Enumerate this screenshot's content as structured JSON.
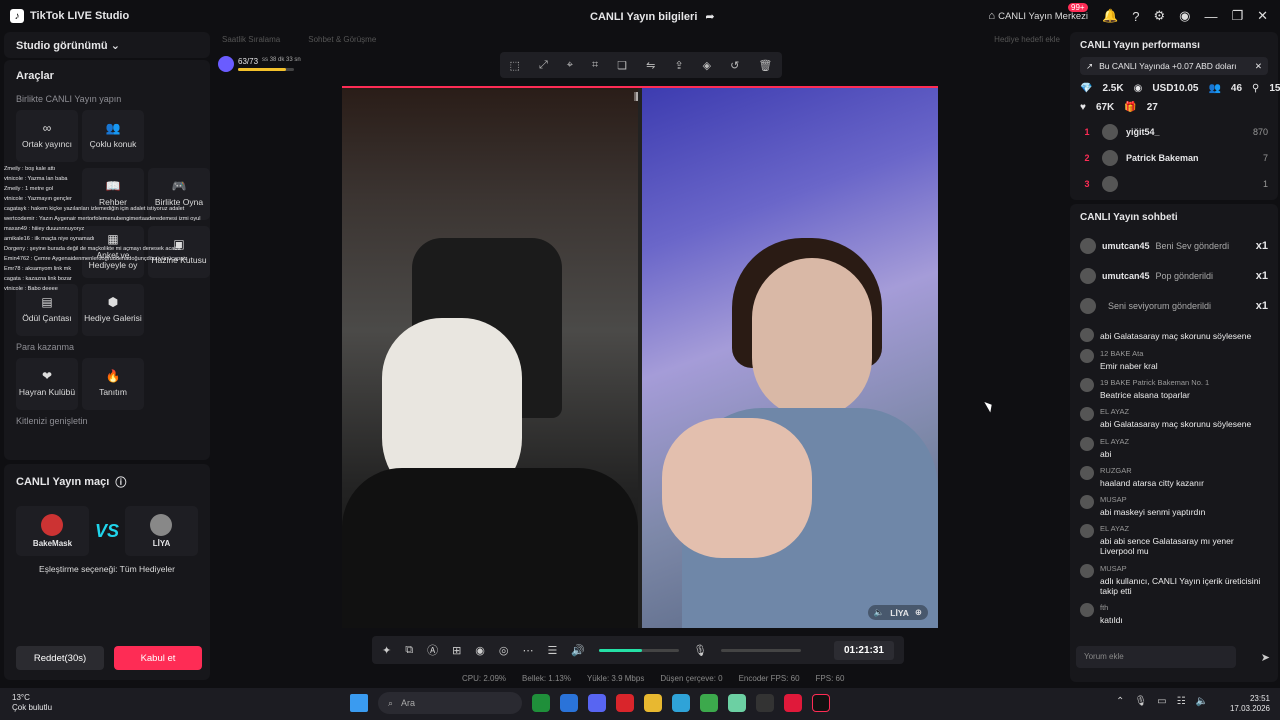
{
  "window": {
    "app_title": "TikTok LIVE Studio",
    "center_title": "CANLI Yayın bilgileri",
    "center_right": "CANLI Yayın Merkezi",
    "notif_badge": "99+"
  },
  "left": {
    "studio_view": "Studio görünümü",
    "tools_title": "Araçlar",
    "section_live_together": "Birlikte CANLI Yayın yapın",
    "tools_row1": [
      "Ortak yayıncı",
      "Çoklu konuk"
    ],
    "tools_row2": [
      "Rehber",
      "Birlikte Oyna"
    ],
    "tools_row3": [
      "Anket ve Hediyeyle oy",
      "Hazine Kutusu"
    ],
    "tools_row4": [
      "Ödül Çantası",
      "Hediye Galerisi"
    ],
    "section_monetize": "Para kazanma",
    "tools_row5": [
      "Hayran Kulübü",
      "Tanıtım"
    ],
    "section_expand": "Kitlenizi genişletin",
    "chat_overlay": [
      "Zmeily : boş kale attı",
      "vtnicole : Yazma lan baba",
      "Zmeily : 1 metre gol",
      "vtnicole : Yazmayın gençler",
      "cagatayk : hakem kiçke yazılanları izlemediğin için adalet istiyoruz adalet",
      "wertcodemir : Yazın Aygenair mertorfolemenubengimertaaderedemesi izmi oyul",
      "maxan49 : hiiiey duuunnnuyoryz",
      "arnikale16 : ilk maçta niye oynamadı",
      "Dorgeny : şeyine burada değil de maçkolikte mi açmayı denesek acaba",
      "Emin4762 : Çemre Aygenaidenmenlerdoğruddenadoğunçdönüvünücapaiz",
      "Emr78 : aksamyom link mk",
      "cagata : kazazna link bozar",
      "vtnicole : Babo deeee"
    ],
    "battle_title": "CANLI Yayın maçı",
    "player1": "BakeMask",
    "player2": "LİYA",
    "vs": "VS",
    "match_option": "Eşleştirme seçeneği: Tüm Hediyeler",
    "btn_reject": "Reddet(30s)",
    "btn_accept": "Kabul et"
  },
  "stage": {
    "tab1": "Saatlik Sıralama",
    "tab2": "Sohbet & Görüşme",
    "gift_tab": "Hediye hedefi ekle",
    "goal_text": "63/73",
    "goal_time": "ss 38 dk 33 sn",
    "goal_progress": 0.86,
    "guest_name": "LİYA",
    "timer": "01:21:31",
    "stats": {
      "cpu": "CPU: 2.09%",
      "memory": "Bellek: 1.13%",
      "upload": "Yükle: 3.9 Mbps",
      "dropped": "Düşen çerçeve: 0",
      "encoder": "Encoder FPS: 60",
      "fps": "FPS: 60"
    },
    "volume_level": 0.54
  },
  "right": {
    "perf_title": "CANLI Yayın performansı",
    "perf_note": "Bu CANLI Yayında +0.07 ABD doları",
    "stat_diamonds": "2.5K",
    "stat_usd": "USD10.05",
    "stat_viewers": "46",
    "stat_new": "15",
    "stat_likes": "67K",
    "stat_gifts": "27",
    "ranking": [
      {
        "rank": "1",
        "name": "yiğit54_",
        "score": "870"
      },
      {
        "rank": "2",
        "name": "Patrick Bakeman",
        "score": "7"
      },
      {
        "rank": "3",
        "name": "",
        "score": "1"
      }
    ],
    "chat_title": "CANLI Yayın sohbeti",
    "gifts": [
      {
        "user": "umutcan45",
        "action": "Beni Sev gönderdi",
        "count": "x1"
      },
      {
        "user": "umutcan45",
        "action": "Pop gönderildi",
        "count": "x1"
      },
      {
        "user": "",
        "action": "Seni seviyorum gönderildi",
        "count": "x1"
      }
    ],
    "messages": [
      {
        "nick": "",
        "text": "abi Galatasaray maç skorunu söylesene"
      },
      {
        "nick": "12 BAKE Ata",
        "text": "Emir naber kral"
      },
      {
        "nick": "19 BAKE Patrick Bakeman No. 1",
        "text": "Beatrice alsana toparlar"
      },
      {
        "nick": "EL AYAZ",
        "text": "abi Galatasaray maç skorunu söylesene"
      },
      {
        "nick": "EL AYAZ",
        "text": "abi"
      },
      {
        "nick": "RUZGAR",
        "text": "haaland atarsa citty kazanır"
      },
      {
        "nick": "MUSAP",
        "text": "abi maskeyi senmi yaptırdın"
      },
      {
        "nick": "EL AYAZ",
        "text": "abi abi sence Galatasaray mı yener Liverpool mu"
      },
      {
        "nick": "MUSAP",
        "text": "adlı kullanıcı, CANLI Yayın içerik üreticisini takip etti"
      },
      {
        "nick": "fth",
        "text": "katıldı"
      }
    ],
    "chat_placeholder": "Yorum ekle"
  },
  "taskbar": {
    "temp": "13°C",
    "weather": "Çok bulutlu",
    "search": "Ara",
    "time": "23:51",
    "date": "17.03.2026"
  }
}
